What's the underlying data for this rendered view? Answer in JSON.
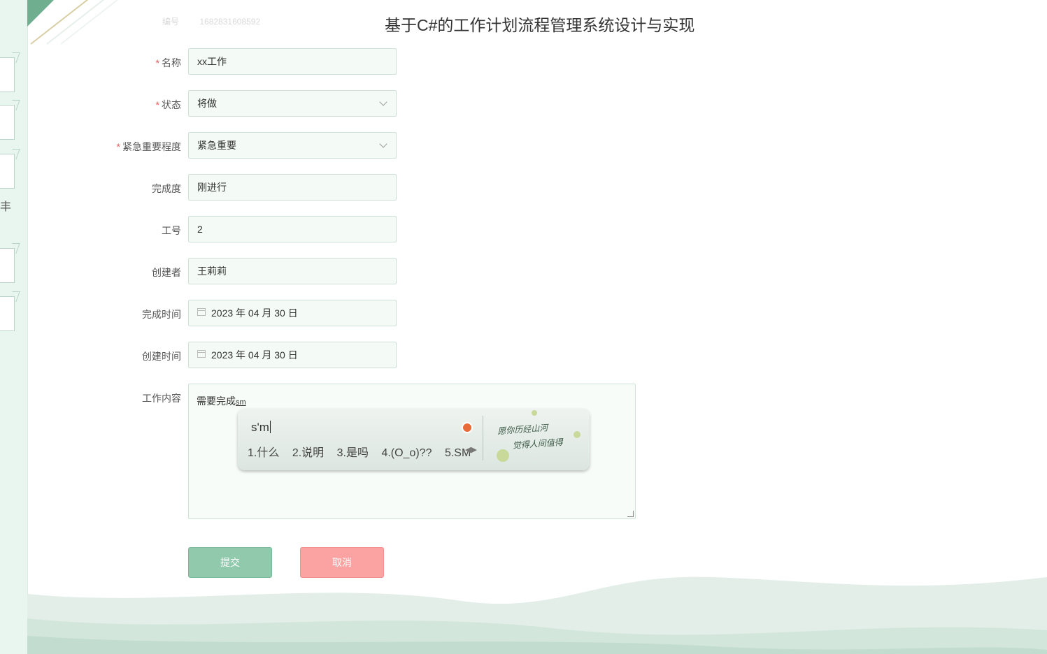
{
  "page": {
    "title": "基于C#的工作计划流程管理系统设计与实现"
  },
  "faded_header": {
    "label": "编号",
    "value": "1682831608592"
  },
  "left_rail": {
    "glyph": "丰"
  },
  "form": {
    "fields": {
      "name": {
        "label": "名称",
        "required": true,
        "value": "xx工作"
      },
      "status": {
        "label": "状态",
        "required": true,
        "value": "将做"
      },
      "priority": {
        "label": "紧急重要程度",
        "required": true,
        "value": "紧急重要"
      },
      "progress": {
        "label": "完成度",
        "required": false,
        "value": "刚进行"
      },
      "employee_no": {
        "label": "工号",
        "required": false,
        "value": "2"
      },
      "creator": {
        "label": "创建者",
        "required": false,
        "value": "王莉莉"
      },
      "finish_time": {
        "label": "完成时间",
        "required": false,
        "value": "2023 年 04 月 30 日"
      },
      "create_time": {
        "label": "创建时间",
        "required": false,
        "value": "2023 年 04 月 30 日"
      },
      "content": {
        "label": "工作内容",
        "required": false,
        "value": "需要完成",
        "composing": "sm"
      }
    },
    "buttons": {
      "submit": "提交",
      "cancel": "取消"
    },
    "required_mark": "*"
  },
  "ime": {
    "input": "s'm",
    "candidates": [
      "1.什么",
      "2.说明",
      "3.是吗",
      "4.(O_o)??",
      "5.SM"
    ],
    "arrows": "◀▶",
    "skin_text": [
      "愿你历经山河",
      "觉得人间值得"
    ]
  },
  "colors": {
    "accent_green": "#90c9ac",
    "cancel_red": "#fba3a3",
    "field_border": "#cfe3d8",
    "required": "#e25b5b"
  }
}
